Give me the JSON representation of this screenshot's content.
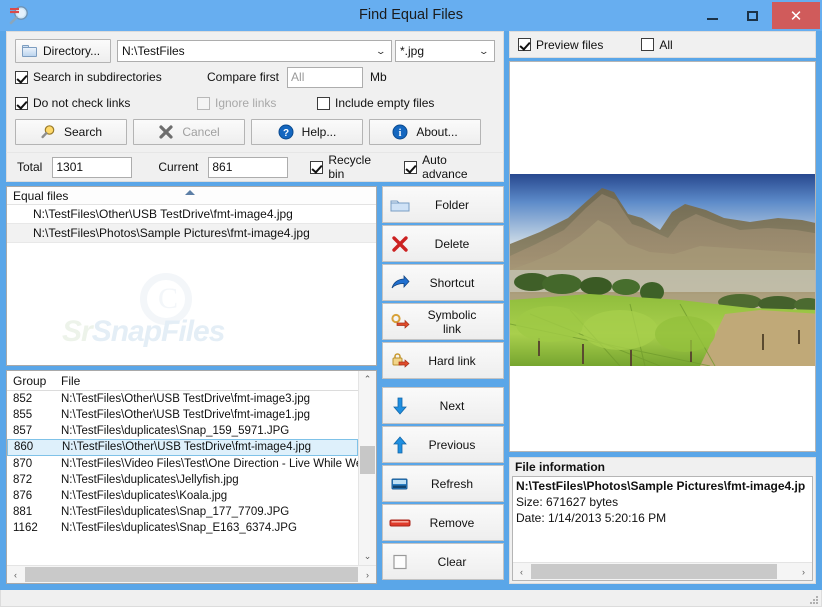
{
  "window": {
    "title": "Find Equal Files",
    "app_icon": "magnifier-icon",
    "minimize_label": "Minimize",
    "maximize_label": "Maximize",
    "close_label": "✕"
  },
  "toolbar": {
    "directory_button": "Directory...",
    "directory_value": "N:\\TestFiles",
    "mask_value": "*.jpg"
  },
  "options": {
    "search_subdirs": {
      "label": "Search in subdirectories",
      "checked": true
    },
    "compare_first_label": "Compare first",
    "compare_first_value": "All",
    "compare_first_unit": "Mb",
    "do_not_check_links": {
      "label": "Do not check links",
      "checked": true
    },
    "ignore_links": {
      "label": "Ignore links",
      "checked": false,
      "disabled": true
    },
    "include_empty_files": {
      "label": "Include empty files",
      "checked": false
    },
    "search_button": "Search",
    "cancel_button": "Cancel",
    "help_button": "Help...",
    "about_button": "About..."
  },
  "counters": {
    "total_label": "Total",
    "total_value": "1301",
    "current_label": "Current",
    "current_value": "861",
    "recycle_bin": {
      "label": "Recycle bin",
      "checked": true
    },
    "auto_advance": {
      "label": "Auto advance",
      "checked": true
    }
  },
  "equal_files": {
    "header": "Equal files",
    "rows": [
      {
        "path": "N:\\TestFiles\\Other\\USB TestDrive\\fmt-image4.jpg",
        "selected": false
      },
      {
        "path": "N:\\TestFiles\\Photos\\Sample Pictures\\fmt-image4.jpg",
        "selected": true
      }
    ],
    "watermark": "SnapFiles"
  },
  "file_actions": [
    {
      "label": "Folder",
      "icon": "folder-icon"
    },
    {
      "label": "Delete",
      "icon": "red-x-icon"
    },
    {
      "label": "Shortcut",
      "icon": "shortcut-arrow-icon"
    },
    {
      "label": "Symbolic link",
      "icon": "symbolic-link-icon"
    },
    {
      "label": "Hard link",
      "icon": "hard-link-icon"
    }
  ],
  "nav_actions": [
    {
      "label": "Next",
      "icon": "down-arrow-icon"
    },
    {
      "label": "Previous",
      "icon": "up-arrow-icon"
    },
    {
      "label": "Refresh",
      "icon": "refresh-icon"
    },
    {
      "label": "Remove",
      "icon": "remove-icon"
    },
    {
      "label": "Clear",
      "icon": "clear-icon"
    }
  ],
  "groups_grid": {
    "columns": [
      "Group",
      "File"
    ],
    "rows": [
      {
        "group": "852",
        "file": "N:\\TestFiles\\Other\\USB TestDrive\\fmt-image3.jpg",
        "selected": false
      },
      {
        "group": "855",
        "file": "N:\\TestFiles\\Other\\USB TestDrive\\fmt-image1.jpg",
        "selected": false
      },
      {
        "group": "857",
        "file": "N:\\TestFiles\\duplicates\\Snap_159_5971.JPG",
        "selected": false
      },
      {
        "group": "860",
        "file": "N:\\TestFiles\\Other\\USB TestDrive\\fmt-image4.jpg",
        "selected": true
      },
      {
        "group": "870",
        "file": "N:\\TestFiles\\Video Files\\Test\\One Direction - Live While We're.",
        "selected": false
      },
      {
        "group": "872",
        "file": "N:\\TestFiles\\duplicates\\Jellyfish.jpg",
        "selected": false
      },
      {
        "group": "876",
        "file": "N:\\TestFiles\\duplicates\\Koala.jpg",
        "selected": false
      },
      {
        "group": "881",
        "file": "N:\\TestFiles\\duplicates\\Snap_177_7709.JPG",
        "selected": false
      },
      {
        "group": "1162",
        "file": "N:\\TestFiles\\duplicates\\Snap_E163_6374.JPG",
        "selected": false
      }
    ]
  },
  "preview": {
    "preview_files": {
      "label": "Preview files",
      "checked": true
    },
    "all": {
      "label": "All",
      "checked": false
    },
    "image_description": "mountain-and-vineyard-landscape-photo"
  },
  "file_information": {
    "header": "File information",
    "path": "N:\\TestFiles\\Photos\\Sample Pictures\\fmt-image4.jp",
    "size": "Size: 671627 bytes",
    "date": "Date:  1/14/2013 5:20:16 PM"
  },
  "colors": {
    "title_bar": "#67aef0",
    "window_frame": "#5aa6e8",
    "close_button": "#d05b5b",
    "selection": "#def0fb",
    "selection_border": "#7fc2e8"
  }
}
